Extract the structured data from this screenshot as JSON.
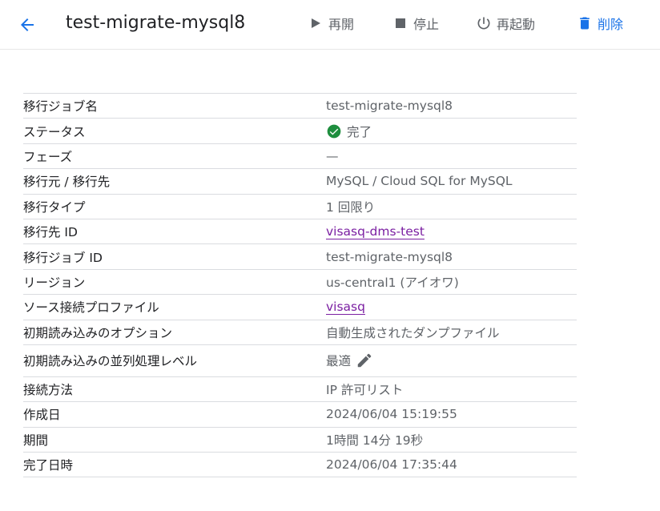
{
  "header": {
    "title": "test-migrate-mysql8",
    "actions": {
      "resume": "再開",
      "stop": "停止",
      "restart": "再起動",
      "delete": "削除"
    }
  },
  "colors": {
    "accent": "#1a73e8",
    "link": "#7b1fa2",
    "success": "#1e8e3e",
    "muted": "#5f6368"
  },
  "details": {
    "job_name": {
      "label": "移行ジョブ名",
      "value": "test-migrate-mysql8"
    },
    "status": {
      "label": "ステータス",
      "value": "完了",
      "icon": "check-circle-icon"
    },
    "phase": {
      "label": "フェーズ",
      "value": "—"
    },
    "source_dest": {
      "label": "移行元 / 移行先",
      "value": "MySQL / Cloud SQL for MySQL"
    },
    "migration_type": {
      "label": "移行タイプ",
      "value": "1 回限り"
    },
    "destination_id": {
      "label": "移行先 ID",
      "value": "visasq-dms-test"
    },
    "job_id": {
      "label": "移行ジョブ ID",
      "value": "test-migrate-mysql8"
    },
    "region": {
      "label": "リージョン",
      "value": "us-central1 (アイオワ)"
    },
    "source_profile": {
      "label": "ソース接続プロファイル",
      "value": "visasq"
    },
    "initial_load_option": {
      "label": "初期読み込みのオプション",
      "value": "自動生成されたダンプファイル"
    },
    "parallel_level": {
      "label": "初期読み込みの並列処理レベル",
      "value": "最適",
      "icon": "pencil-icon"
    },
    "connection_method": {
      "label": "接続方法",
      "value": "IP 許可リスト"
    },
    "created": {
      "label": "作成日",
      "value": "2024/06/04 15:19:55"
    },
    "duration": {
      "label": "期間",
      "value": "1時間 14分 19秒"
    },
    "completed": {
      "label": "完了日時",
      "value": "2024/06/04 17:35:44"
    }
  }
}
